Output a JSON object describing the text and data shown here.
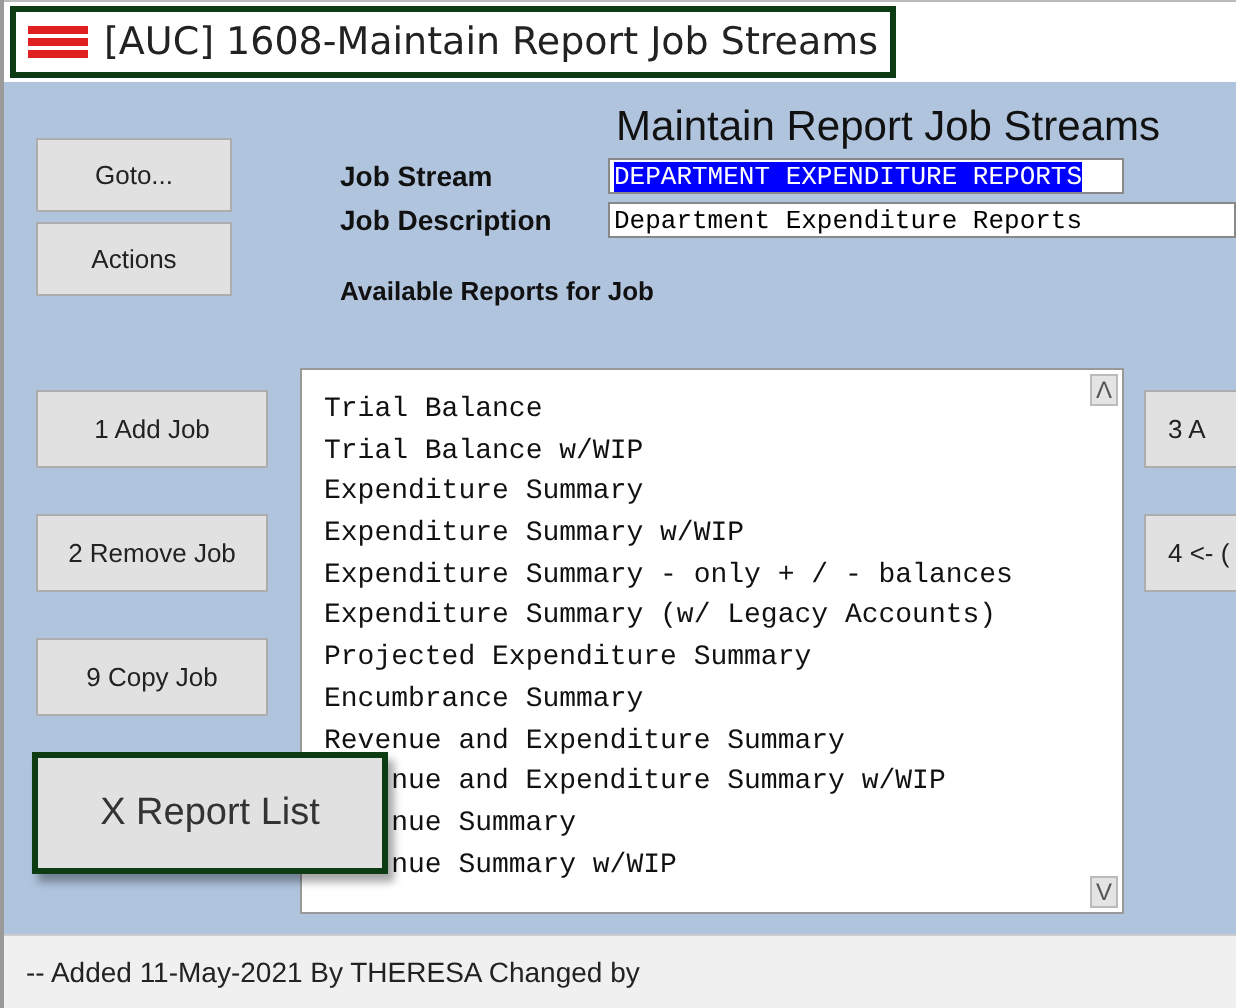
{
  "window": {
    "title": "[AUC] 1608-Maintain Report Job Streams"
  },
  "heading": "Maintain Report Job Streams",
  "top_buttons": [
    "Goto...",
    "Actions"
  ],
  "fields": [
    {
      "label": "Job Stream",
      "value": "DEPARTMENT EXPENDITURE REPORTS",
      "selected": true
    },
    {
      "label": "Job Description",
      "value": "Department Expenditure Reports",
      "selected": false
    }
  ],
  "list_label": "Available Reports for Job",
  "left_buttons": [
    "1 Add Job",
    "2 Remove Job",
    "9 Copy Job"
  ],
  "right_buttons": [
    "3 A",
    "4 <- ("
  ],
  "reports": [
    {
      "text": "Trial Balance",
      "kind": "full"
    },
    {
      "text": "Trial Balance w/WIP",
      "kind": "full"
    },
    {
      "text": "Expenditure Summary",
      "kind": "full"
    },
    {
      "text": "Expenditure Summary w/WIP",
      "kind": "full"
    },
    {
      "text": "Expenditure Summary - only + / - balances",
      "kind": "full"
    },
    {
      "text": "Expenditure Summary (w/ Legacy Accounts)",
      "kind": "full"
    },
    {
      "text": "Projected Expenditure Summary",
      "kind": "full"
    },
    {
      "text": "Encumbrance Summary",
      "kind": "full"
    },
    {
      "text": "Revenue and Expenditure Summary",
      "kind": "full"
    },
    {
      "text": "nue and Expenditure Summary w/WIP",
      "kind": "partial"
    },
    {
      "text": "nue Summary",
      "kind": "partial"
    },
    {
      "text": "nue Summary w/WIP",
      "kind": "partial"
    }
  ],
  "scroll_up": "Λ",
  "scroll_down": "V",
  "callout_button": "X Report List",
  "status_bar": "-- Added 11-May-2021 By THERESA Changed  by"
}
